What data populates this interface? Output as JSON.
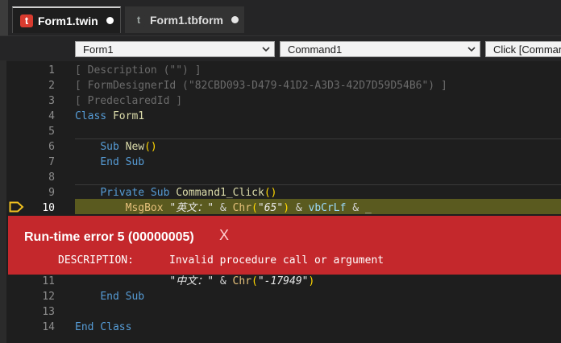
{
  "tabs": [
    {
      "icon": "t",
      "label": "Form1.twin"
    },
    {
      "icon": "t",
      "label": "Form1.tbform"
    }
  ],
  "dropdowns": {
    "object": "Form1",
    "member": "Command1",
    "event": "Click [Command"
  },
  "code": {
    "lines": [
      {
        "num": "1",
        "parts": [
          [
            "gray",
            "[ Description (\"\") ]"
          ]
        ]
      },
      {
        "num": "2",
        "parts": [
          [
            "gray",
            "[ FormDesignerId (\"82CBD093-D479-41D2-A3D3-42D7D59D54B6\") ]"
          ]
        ]
      },
      {
        "num": "3",
        "parts": [
          [
            "gray",
            "[ PredeclaredId ]"
          ]
        ]
      },
      {
        "num": "4",
        "parts": [
          [
            "kw",
            "Class "
          ],
          [
            "id",
            "Form1"
          ]
        ]
      },
      {
        "num": "5",
        "parts": []
      },
      {
        "num": "6",
        "parts": [
          [
            "op",
            "    "
          ],
          [
            "kw",
            "Sub "
          ],
          [
            "fn",
            "New"
          ],
          [
            "pl",
            "()"
          ]
        ]
      },
      {
        "num": "7",
        "parts": [
          [
            "op",
            "    "
          ],
          [
            "kw",
            "End Sub"
          ]
        ]
      },
      {
        "num": "8",
        "parts": []
      },
      {
        "num": "9",
        "parts": [
          [
            "op",
            "    "
          ],
          [
            "kw",
            "Private Sub "
          ],
          [
            "fn",
            "Command1_Click"
          ],
          [
            "pl",
            "()"
          ]
        ]
      },
      {
        "num": "10",
        "parts": [
          [
            "op",
            "        "
          ],
          [
            "yl",
            "MsgBox "
          ],
          [
            "str",
            "\"英文：\""
          ],
          [
            "op",
            " & "
          ],
          [
            "yl",
            "Chr"
          ],
          [
            "pl",
            "("
          ],
          [
            "str",
            "\"65\""
          ],
          [
            "pl",
            ")"
          ],
          [
            "op",
            " & "
          ],
          [
            "vb",
            "vbCrLf"
          ],
          [
            "op",
            " & _"
          ]
        ]
      },
      {
        "num": "11",
        "parts": [
          [
            "op",
            "               "
          ],
          [
            "str",
            "\"中文：\""
          ],
          [
            "op",
            " & "
          ],
          [
            "yl",
            "Chr"
          ],
          [
            "pl",
            "("
          ],
          [
            "str",
            "\"-17949\""
          ],
          [
            "pl",
            ")"
          ]
        ]
      },
      {
        "num": "12",
        "parts": [
          [
            "op",
            "    "
          ],
          [
            "kw",
            "End Sub"
          ]
        ]
      },
      {
        "num": "13",
        "parts": []
      },
      {
        "num": "14",
        "parts": [
          [
            "kw",
            "End Class"
          ]
        ]
      }
    ]
  },
  "error": {
    "title": "Run-time error 5 (00000005)",
    "close": "X",
    "description_label": "DESCRIPTION:",
    "description_text": "Invalid procedure call or argument"
  },
  "colors": {
    "error_bg": "#c4282c",
    "current_line": "#5a5a1f",
    "breakpoint": "#f0c020",
    "twin_icon": "#d83b2f"
  }
}
